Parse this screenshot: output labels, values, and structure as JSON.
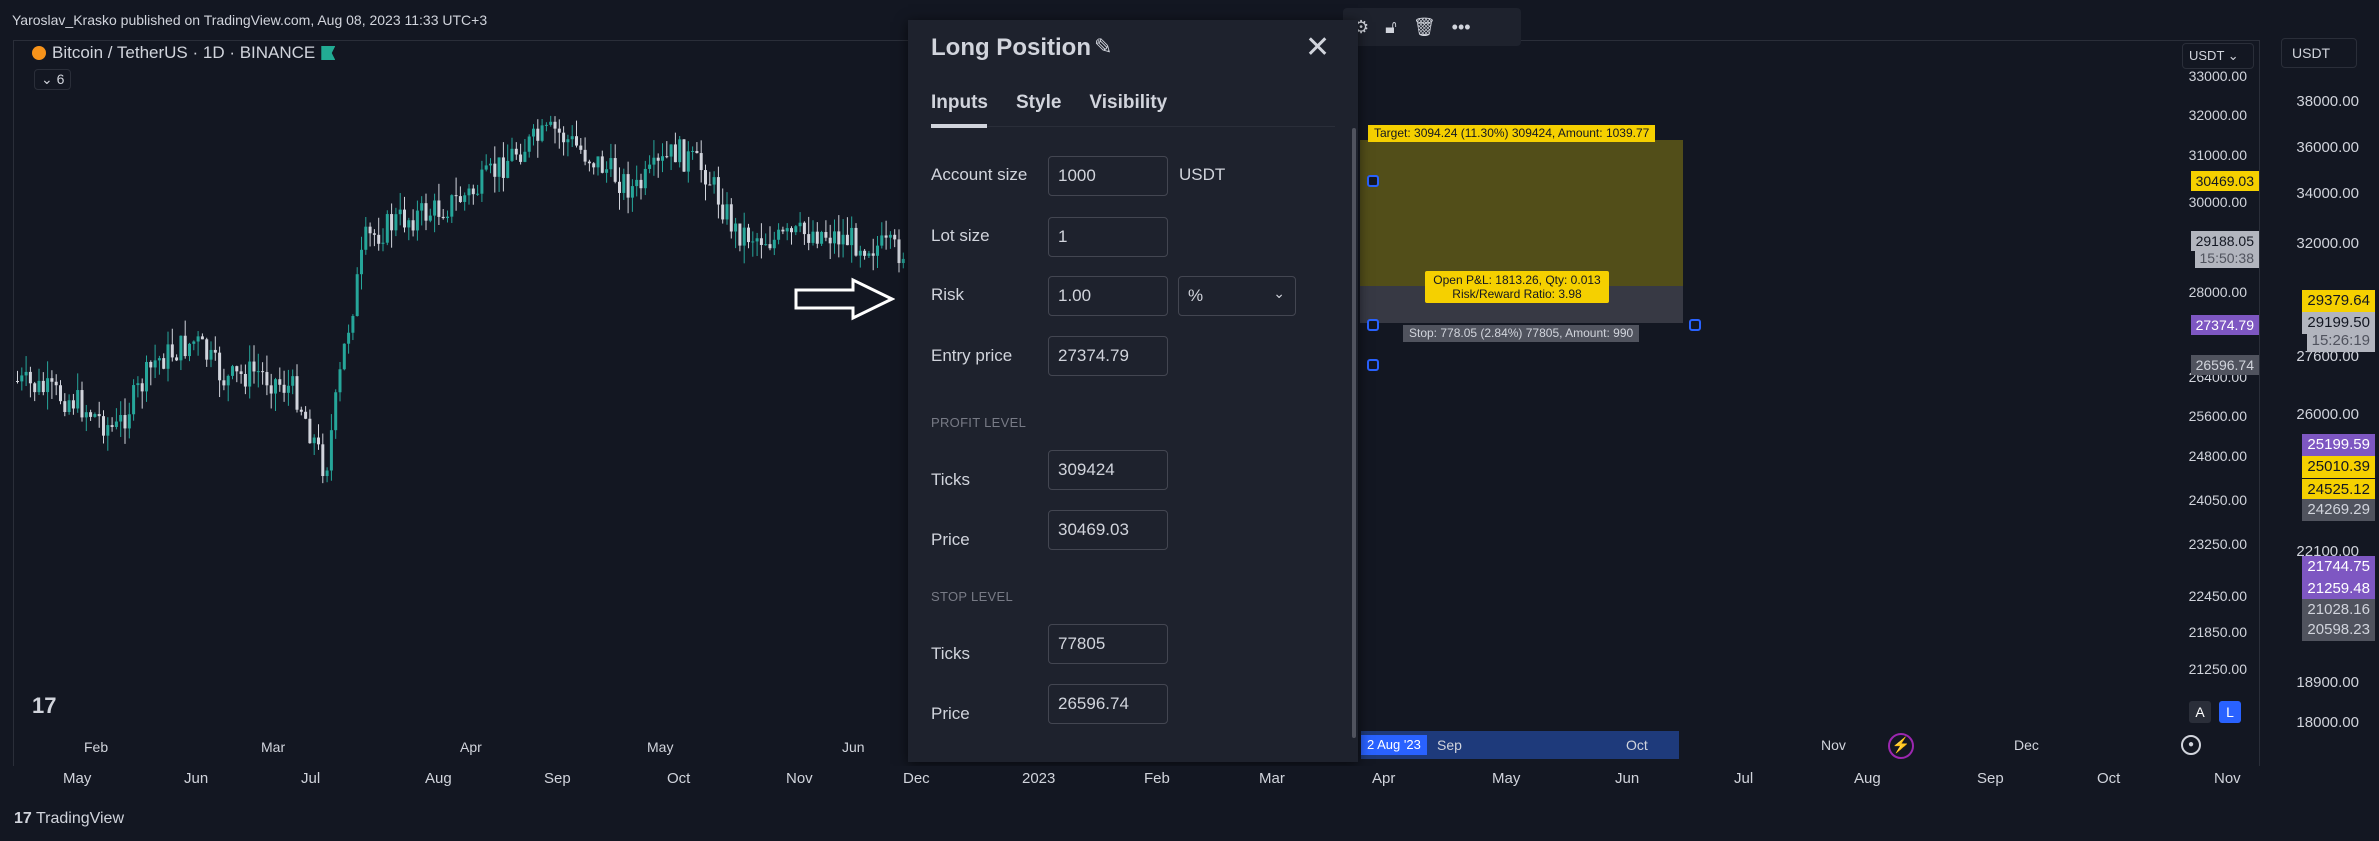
{
  "publish_line": "Yaroslav_Krasko published on TradingView.com, Aug 08, 2023 11:33 UTC+3",
  "symbol": {
    "name": "Bitcoin / TetherUS · 1D · BINANCE",
    "indicators_badge": "6"
  },
  "inner_chart": {
    "months": [
      "Feb",
      "Mar",
      "Apr",
      "May",
      "Jun"
    ],
    "timeline": {
      "date_badge": "2 Aug '23",
      "months": [
        "Sep",
        "Oct",
        "Nov",
        "Dec"
      ]
    },
    "currency": "USDT",
    "price_ticks": [
      "33000.00",
      "32000.00",
      "31000.00",
      "30000.00",
      "28000.00",
      "27200.00",
      "26400.00",
      "25600.00",
      "24800.00",
      "24050.00",
      "23250.00",
      "22450.00",
      "21850.00",
      "21250.00"
    ],
    "price_pills": [
      {
        "text": "30469.03",
        "bg": "#f5d000",
        "fg": "#131722"
      },
      {
        "text": "29188.05",
        "bg": "#b2b5be",
        "fg": "#131722"
      },
      {
        "text": "15:50:38",
        "bg": "#b2b5be",
        "fg": "#50535e"
      },
      {
        "text": "27374.79",
        "bg": "#7e57c2",
        "fg": "#ffffff"
      },
      {
        "text": "26596.74",
        "bg": "#50535e",
        "fg": "#d1d4dc"
      }
    ],
    "scale_buttons": [
      "A",
      "L"
    ],
    "toolbar_icons": [
      "gear-icon",
      "lock-icon",
      "trash-icon",
      "more-icon"
    ],
    "position_labels": {
      "target": "Target: 3094.24 (11.30%) 309424, Amount: 1039.77",
      "open_line1": "Open P&L: 1813.26, Qty: 0.013",
      "open_line2": "Risk/Reward Ratio: 3.98",
      "stop": "Stop: 778.05 (2.84%) 77805, Amount: 990"
    }
  },
  "dialog": {
    "title": "Long Position",
    "tabs": [
      "Inputs",
      "Style",
      "Visibility"
    ],
    "active_tab": "Inputs",
    "account_size": {
      "label": "Account size",
      "value": "1000",
      "unit": "USDT"
    },
    "lot_size": {
      "label": "Lot size",
      "value": "1"
    },
    "risk": {
      "label": "Risk",
      "value": "1.00",
      "unit_option": "%"
    },
    "entry_price": {
      "label": "Entry price",
      "value": "27374.79"
    },
    "profit_level": {
      "heading": "PROFIT LEVEL",
      "ticks_label": "Ticks",
      "ticks": "309424",
      "price_label": "Price",
      "price": "30469.03"
    },
    "stop_level": {
      "heading": "STOP LEVEL",
      "ticks_label": "Ticks",
      "ticks": "77805",
      "price_label": "Price",
      "price": "26596.74"
    }
  },
  "right_axis": {
    "currency": "USDT",
    "ticks": [
      "38000.00",
      "36000.00",
      "34000.00",
      "32000.00",
      "27600.00",
      "26000.00",
      "22100.00",
      "18900.00",
      "18000.00"
    ],
    "pills": [
      {
        "text": "29379.64",
        "bg": "#f5d000",
        "fg": "#131722"
      },
      {
        "text": "29199.50",
        "bg": "#b2b5be",
        "fg": "#131722"
      },
      {
        "text": "15:26:19",
        "bg": "#b2b5be",
        "fg": "#50535e"
      },
      {
        "text": "25199.59",
        "bg": "#7e57c2",
        "fg": "#ffffff"
      },
      {
        "text": "25010.39",
        "bg": "#f5d000",
        "fg": "#131722"
      },
      {
        "text": "24525.12",
        "bg": "#f5d000",
        "fg": "#131722"
      },
      {
        "text": "24269.29",
        "bg": "#50535e",
        "fg": "#d1d4dc"
      },
      {
        "text": "21744.75",
        "bg": "#7e57c2",
        "fg": "#ffffff"
      },
      {
        "text": "21259.48",
        "bg": "#7e57c2",
        "fg": "#ffffff"
      },
      {
        "text": "21028.16",
        "bg": "#50535e",
        "fg": "#d1d4dc"
      },
      {
        "text": "20598.23",
        "bg": "#50535e",
        "fg": "#d1d4dc"
      }
    ]
  },
  "bottom_axis": [
    "May",
    "Jun",
    "Jul",
    "Aug",
    "Sep",
    "Oct",
    "Nov",
    "Dec",
    "2023",
    "Feb",
    "Mar",
    "Apr",
    "May",
    "Jun",
    "Jul",
    "Aug",
    "Sep",
    "Oct",
    "Nov"
  ],
  "footer": {
    "brand": "TradingView"
  },
  "colors": {
    "background": "#131722",
    "panel": "#1e222d",
    "up_candle": "#26a69a",
    "down_candle": "#d1d4dc",
    "accent": "#2962ff",
    "target_yellow": "#f5d000"
  }
}
